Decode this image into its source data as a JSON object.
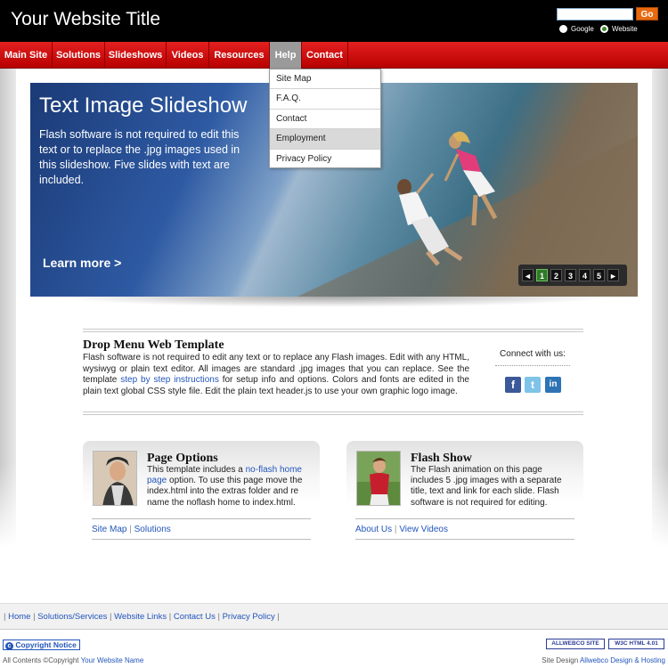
{
  "header": {
    "title": "Your Website Title",
    "search": {
      "value": "",
      "go_label": "Go"
    },
    "radio_google": "Google",
    "radio_website": "Website",
    "radio_selected": "Website"
  },
  "nav": {
    "items": [
      "Main Site",
      "Solutions",
      "Slideshows",
      "Videos",
      "Resources",
      "Help",
      "Contact"
    ],
    "active": "Help"
  },
  "dropdown": {
    "items": [
      "Site Map",
      "F.A.Q.",
      "Contact",
      "Employment",
      "Privacy Policy"
    ],
    "highlighted": "Employment"
  },
  "slideshow": {
    "title": "Text Image Slideshow",
    "text": "Flash software is not required to edit this text or to replace the .jpg images used in this slideshow. Five slides with text are included.",
    "learn_more": "Learn more >",
    "pager": {
      "prev": "◄",
      "pages": [
        "1",
        "2",
        "3",
        "4",
        "5"
      ],
      "next": "►",
      "current": "1"
    }
  },
  "intro": {
    "title": "Drop Menu Web Template",
    "text_before_link": "Flash software is not required to edit any text or to replace any Flash images. Edit with any HTML, wysiwyg or plain text editor. All images are standard .jpg images that you can replace. See the template ",
    "link": "step by step instructions",
    "text_after_link": " for setup info and options. Colors and fonts are edited in the plain text global CSS style file. Edit the plain text header.js to use your own graphic logo image.",
    "connect_label": "Connect with us:",
    "social_icons": [
      "facebook-icon",
      "twitter-icon",
      "linkedin-icon"
    ]
  },
  "boxes": [
    {
      "title": "Page Options",
      "text_before_link": "This template includes a ",
      "link": "no-flash home page",
      "text_after_link": " option. To use this page move the index.html into the extras folder and re name the noflash home to index.html.",
      "links": [
        "Site Map",
        "Solutions"
      ]
    },
    {
      "title": "Flash Show",
      "text": "The Flash animation on this page includes 5 .jpg images with a separate title, text and link for each slide. Flash software is not required for editing.",
      "links": [
        "About Us",
        "View Videos"
      ]
    }
  ],
  "footer": {
    "links": [
      "Home",
      "Solutions/Services",
      "Website Links",
      "Contact Us",
      "Privacy Policy"
    ],
    "copyright_badge": "Copyright Notice",
    "copyright_text": "All Contents ©Copyright ",
    "copyright_link": "Your Website Name",
    "credit_text": "Site Design ",
    "credit_link": "Allwebco Design & Hosting",
    "badge1": "ALLWEBCO SITE",
    "badge2": "W3C HTML 4.01"
  },
  "colors": {
    "nav_red": "#d40000",
    "go_orange": "#e86a10",
    "link_blue": "#2255bb"
  }
}
